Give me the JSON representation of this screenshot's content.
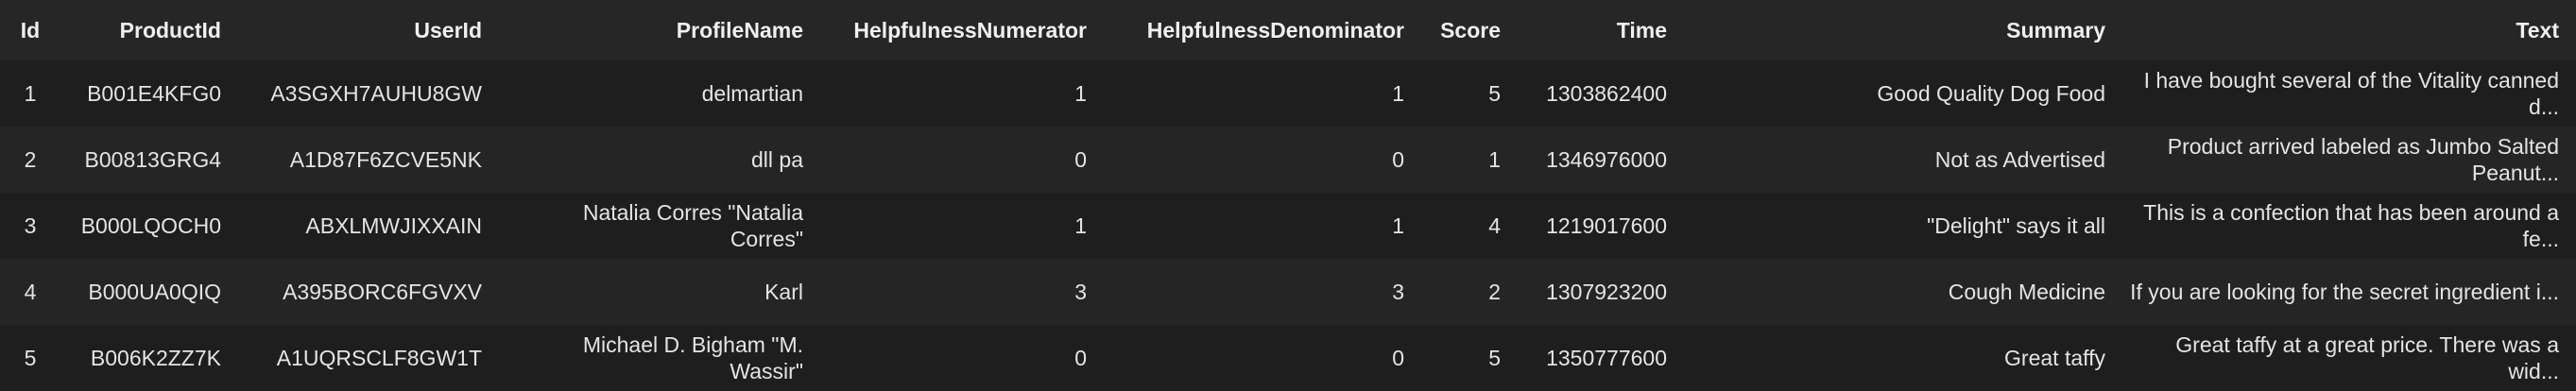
{
  "table": {
    "columns": [
      "Id",
      "ProductId",
      "UserId",
      "ProfileName",
      "HelpfulnessNumerator",
      "HelpfulnessDenominator",
      "Score",
      "Time",
      "Summary",
      "Text"
    ],
    "rows": [
      {
        "id": "1",
        "product_id": "B001E4KFG0",
        "user_id": "A3SGXH7AUHU8GW",
        "profile_name": "delmartian",
        "helpfulness_numerator": "1",
        "helpfulness_denominator": "1",
        "score": "5",
        "time": "1303862400",
        "summary": "Good Quality Dog Food",
        "text": "I have bought several of the Vitality canned d..."
      },
      {
        "id": "2",
        "product_id": "B00813GRG4",
        "user_id": "A1D87F6ZCVE5NK",
        "profile_name": "dll pa",
        "helpfulness_numerator": "0",
        "helpfulness_denominator": "0",
        "score": "1",
        "time": "1346976000",
        "summary": "Not as Advertised",
        "text": "Product arrived labeled as Jumbo Salted Peanut..."
      },
      {
        "id": "3",
        "product_id": "B000LQOCH0",
        "user_id": "ABXLMWJIXXAIN",
        "profile_name": "Natalia Corres \"Natalia Corres\"",
        "helpfulness_numerator": "1",
        "helpfulness_denominator": "1",
        "score": "4",
        "time": "1219017600",
        "summary": "\"Delight\" says it all",
        "text": "This is a confection that has been around a fe..."
      },
      {
        "id": "4",
        "product_id": "B000UA0QIQ",
        "user_id": "A395BORC6FGVXV",
        "profile_name": "Karl",
        "helpfulness_numerator": "3",
        "helpfulness_denominator": "3",
        "score": "2",
        "time": "1307923200",
        "summary": "Cough Medicine",
        "text": "If you are looking for the secret ingredient i..."
      },
      {
        "id": "5",
        "product_id": "B006K2ZZ7K",
        "user_id": "A1UQRSCLF8GW1T",
        "profile_name": "Michael D. Bigham \"M. Wassir\"",
        "helpfulness_numerator": "0",
        "helpfulness_denominator": "0",
        "score": "5",
        "time": "1350777600",
        "summary": "Great taffy",
        "text": "Great taffy at a great price. There was a wid..."
      }
    ]
  },
  "colors": {
    "background": "#1e1e1e",
    "header_background": "#262626",
    "alt_row_background": "#252525",
    "text": "#e4e4e4"
  }
}
